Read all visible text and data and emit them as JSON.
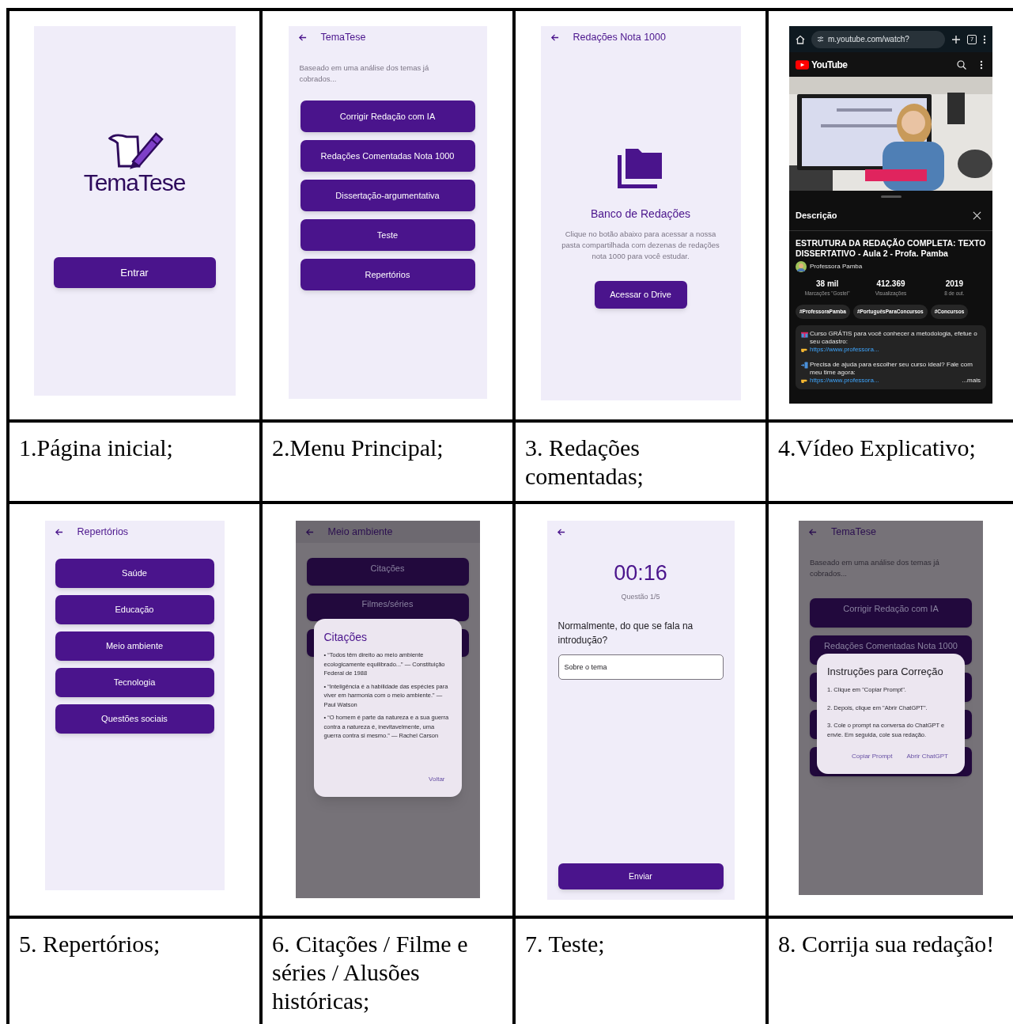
{
  "cells": [
    {
      "caption": "1.Página inicial;",
      "screen": {
        "kind": "splash",
        "logo": "TemaTese",
        "button": "Entrar"
      }
    },
    {
      "caption": "2.Menu Principal;",
      "screen": {
        "kind": "menu",
        "title": "TemaTese",
        "subtitle": "Baseado em uma análise dos temas já cobrados...",
        "buttons": [
          {
            "kind": "labeled",
            "label": "Corrigir Redação com IA"
          },
          {
            "kind": "labeled",
            "label": "Redações Comentadas Nota 1000"
          },
          {
            "kind": "labeled",
            "label": "Dissertação-argumentativa"
          },
          {
            "kind": "labeled",
            "label": "Teste"
          },
          {
            "kind": "labeled",
            "label": "Repertórios"
          }
        ]
      }
    },
    {
      "caption": "3. Redações comentadas;",
      "screen": {
        "kind": "bank",
        "title": "Redações Nota 1000",
        "heading": "Banco de Redações",
        "text": "Clique no botão abaixo para acessar a nossa pasta compartilhada com dezenas de redações nota 1000 para você estudar.",
        "button": "Acessar o Drive"
      }
    },
    {
      "caption": "4.Vídeo Explicativo;",
      "screen": {
        "kind": "video",
        "url": "m.youtube.com/watch?",
        "tab_count": "7",
        "brand": "YouTube",
        "sheet_title": "Descrição",
        "video_title": "ESTRUTURA DA REDAÇÃO COMPLETA: TEXTO DISSERTATIVO - Aula 2 - Profa. Pamba",
        "channel": "Professora Pamba",
        "stats": [
          {
            "value": "38 mil",
            "label": "Marcações \"Gostei\""
          },
          {
            "value": "412.369",
            "label": "Visualizações"
          },
          {
            "value": "2019",
            "label": "8 de out."
          }
        ],
        "tags": [
          "#ProfessoraPamba",
          "#PortuguêsParaConcursos",
          "#Concursos"
        ],
        "description": [
          {
            "kind": "gift",
            "text": "Curso GRÁTIS para você conhecer a metodologia, efetue o seu cadastro:",
            "link": "https://www.professora..."
          },
          {
            "kind": "phone",
            "text": "Precisa de ajuda para escolher seu curso ideal? Fale com meu time agora:",
            "link": "https://www.professora..."
          }
        ],
        "more": "...mais"
      }
    },
    {
      "caption": "5. Repertórios;",
      "screen": {
        "kind": "menu",
        "title": "Repertórios",
        "buttons": [
          {
            "kind": "labeled",
            "label": "Saúde"
          },
          {
            "kind": "labeled",
            "label": "Educação"
          },
          {
            "kind": "labeled",
            "label": "Meio ambiente"
          },
          {
            "kind": "labeled",
            "label": "Tecnologia"
          },
          {
            "kind": "labeled",
            "label": "Questões sociais"
          }
        ]
      }
    },
    {
      "caption": "6. Citações / Filme e séries / Alusões históricas;",
      "screen": {
        "kind": "dialog",
        "background": {
          "title": "Meio ambiente",
          "buttons": [
            {
              "kind": "labeled",
              "label": "Citações"
            },
            {
              "kind": "labeled",
              "label": "Filmes/séries"
            },
            {
              "kind": "blank"
            }
          ]
        },
        "dialog": {
          "title": "Citações",
          "title_accent": true,
          "paragraphs": [
            "• “Todos têm direito ao meio ambiente ecologicamente equilibrado...” — Constituição Federal de 1988",
            "• “Inteligência é a habilidade das espécies para viver em harmonia com o meio ambiente.” — Paul Watson",
            "• “O homem é parte da natureza e a sua guerra contra a natureza é, inevitavelmente, uma guerra contra si mesmo.” — Rachel Carson"
          ],
          "actions": [
            "Voltar"
          ]
        }
      }
    },
    {
      "caption": "7. Teste;",
      "screen": {
        "kind": "quiz",
        "timer": "00:16",
        "progress": "Questão 1/5",
        "question": "Normalmente, do que se fala na introdução?",
        "answer": "Sobre o tema",
        "button": "Enviar"
      }
    },
    {
      "caption": "8. Corrija sua redação!",
      "screen": {
        "kind": "dialog",
        "background": {
          "title": "TemaTese",
          "subtitle": "Baseado em uma análise dos temas já cobrados...",
          "buttons": [
            {
              "kind": "labeled",
              "label": "Corrigir Redação com IA"
            },
            {
              "kind": "labeled",
              "label": "Redações Comentadas Nota 1000"
            },
            {
              "kind": "blank"
            },
            {
              "kind": "blank"
            },
            {
              "kind": "blank"
            }
          ]
        },
        "dialog": {
          "title": "Instruções para Correção",
          "title_accent": false,
          "paragraphs": [
            "1. Clique em \"Copiar Prompt\".",
            "2. Depois, clique em \"Abrir ChatGPT\".",
            "3. Cole o prompt na conversa do ChatGPT e envie. Em seguida, cole sua redação."
          ],
          "actions": [
            "Copiar Prompt",
            "Abrir ChatGPT"
          ]
        }
      }
    }
  ]
}
